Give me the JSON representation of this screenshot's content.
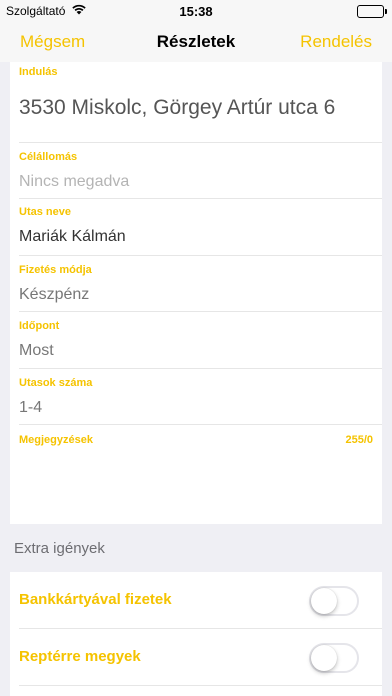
{
  "status_bar": {
    "carrier": "Szolgáltató",
    "time": "15:38",
    "battery": 1.0
  },
  "nav": {
    "cancel": "Mégsem",
    "title": "Részletek",
    "order": "Rendelés"
  },
  "form": {
    "departure": {
      "label": "Indulás",
      "value": "3530 Miskolc, Görgey Artúr utca 6"
    },
    "destination": {
      "label": "Célállomás",
      "placeholder": "Nincs megadva"
    },
    "passenger_name": {
      "label": "Utas neve",
      "value": "Mariák Kálmán"
    },
    "payment_method": {
      "label": "Fizetés módja",
      "value": "Készpénz"
    },
    "time": {
      "label": "Időpont",
      "value": "Most"
    },
    "passenger_count": {
      "label": "Utasok száma",
      "value": "1-4"
    },
    "notes": {
      "label": "Megjegyzések",
      "counter": "255/0"
    }
  },
  "extras": {
    "header": "Extra igények",
    "options": [
      {
        "label": "Bankkártyával fizetek",
        "on": false
      },
      {
        "label": "Reptérre megyek",
        "on": false
      }
    ]
  },
  "colors": {
    "accent": "#f5c300",
    "background": "#efeff4"
  },
  "icons": [
    "wifi-icon",
    "battery-icon"
  ]
}
